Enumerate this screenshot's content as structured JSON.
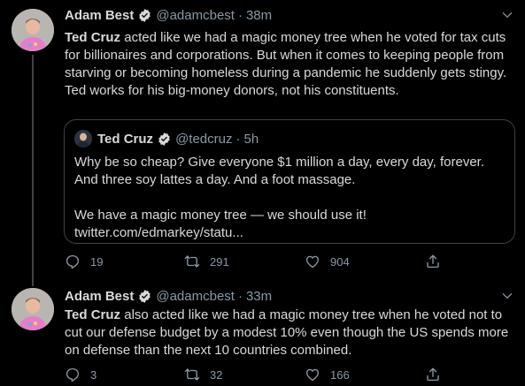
{
  "tweets": [
    {
      "author": "Adam Best",
      "handle": "@adamcbest",
      "separator": "·",
      "time": "38m",
      "text_bold": "Ted Cruz",
      "text_rest": " acted like we had a magic money tree when he voted for tax cuts for billionaires and corporations. But when it comes to keeping people from starving or becoming homeless during a pandemic he suddenly gets stingy. Ted works for his big-money donors, not his constituents.",
      "quote": {
        "author": "Ted Cruz",
        "handle": "@tedcruz",
        "separator": "·",
        "time": "5h",
        "line1": "Why be so cheap?  Give everyone $1 million a day, every day, forever. And three soy lattes a day. And a foot massage.",
        "line2": "We have a magic money tree — we should use it!",
        "link": "twitter.com/edmarkey/statu..."
      },
      "replies": "19",
      "retweets": "291",
      "likes": "904"
    },
    {
      "author": "Adam Best",
      "handle": "@adamcbest",
      "separator": "·",
      "time": "33m",
      "text_bold": "Ted Cruz",
      "text_rest": " also acted like we had a magic money tree when he voted not to cut our defense budget by a modest 10% even though the US spends more on defense than the next 10 countries combined.",
      "replies": "3",
      "retweets": "32",
      "likes": "166"
    }
  ],
  "colors": {
    "background": "#000000",
    "text": "#d9d9d9",
    "muted": "#8899a6",
    "border": "#3d4348",
    "verified": "#d9d9d9"
  },
  "icons": [
    "verified-badge-icon",
    "chevron-down-icon",
    "reply-icon",
    "retweet-icon",
    "like-icon",
    "share-icon"
  ]
}
